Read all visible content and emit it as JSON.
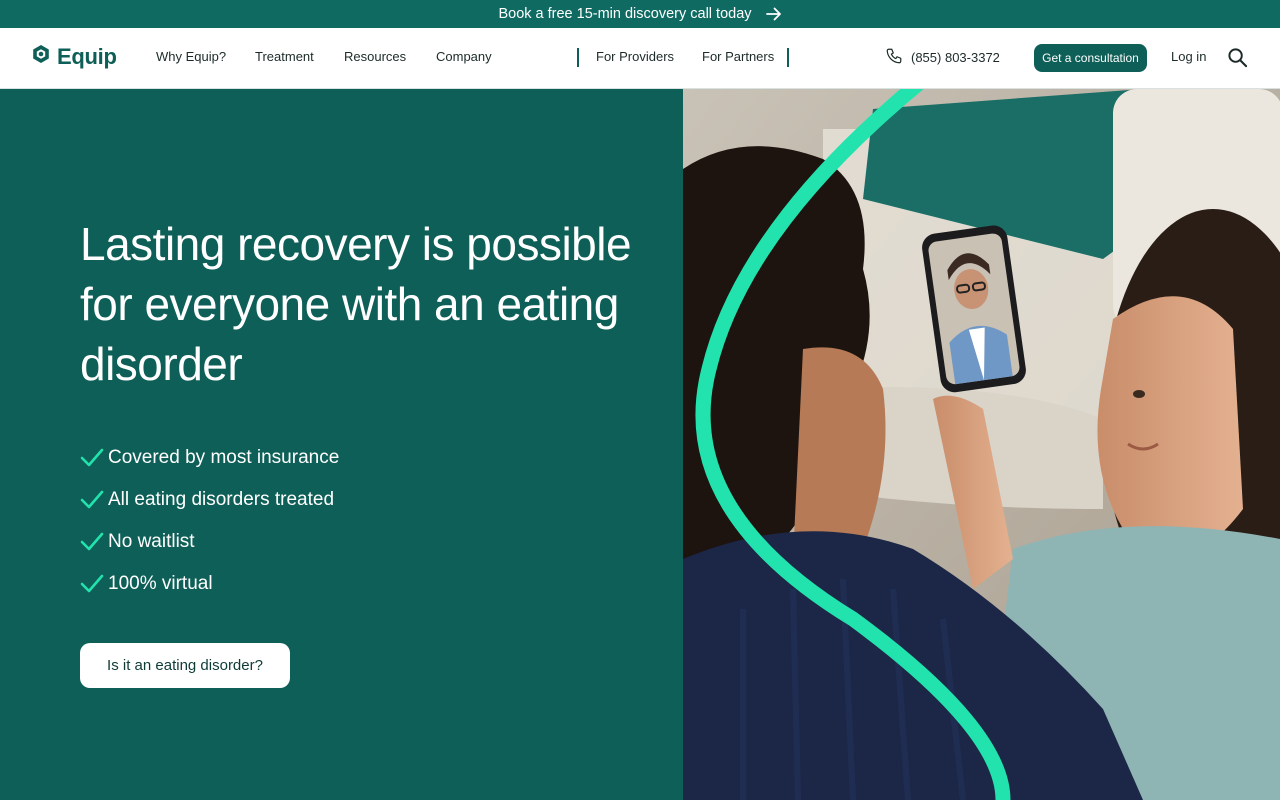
{
  "announcement": {
    "text": "Book a free 15-min discovery call today",
    "icon": "arrow-right-icon"
  },
  "header": {
    "logo_text": "Equip",
    "nav_main": [
      "Why Equip?",
      "Treatment",
      "Resources",
      "Company"
    ],
    "nav_secondary": [
      "For Providers",
      "For Partners"
    ],
    "phone": "(855) 803-3372",
    "cta_label": "Get a consultation",
    "login_label": "Log in",
    "search_icon": "search-icon"
  },
  "hero": {
    "title": "Lasting recovery is possible for everyone with an eating disorder",
    "checklist": [
      "Covered by most insurance",
      "All eating disorders treated",
      "No waitlist",
      "100% virtual"
    ],
    "button_label": "Is it an eating disorder?"
  },
  "colors": {
    "brand_dark": "#0e5f57",
    "topbar": "#0f6b62",
    "accent_mint": "#22e3ad",
    "white": "#ffffff"
  }
}
